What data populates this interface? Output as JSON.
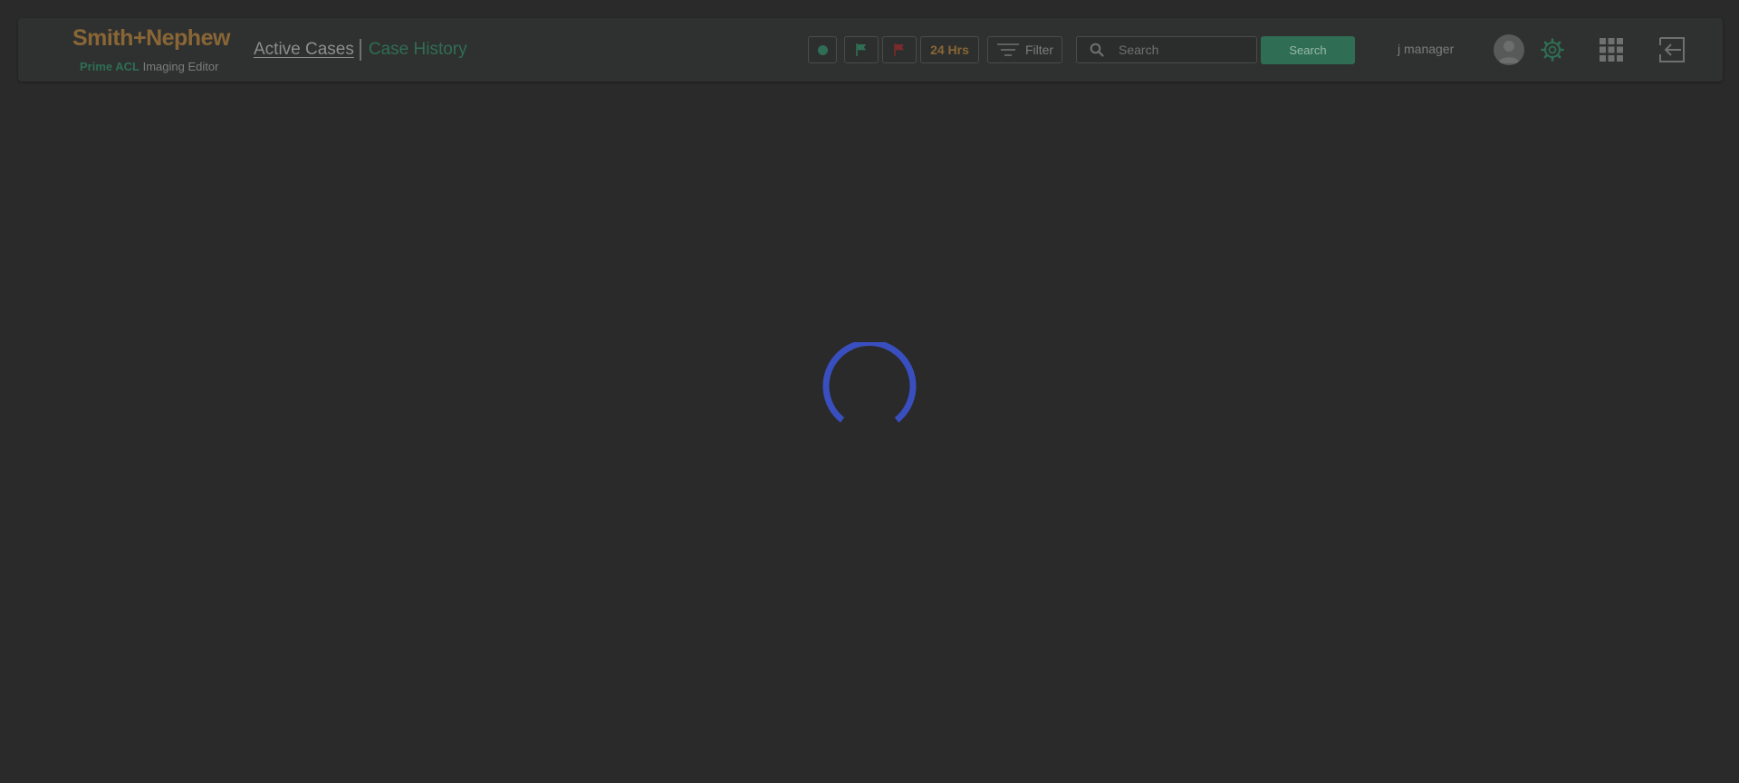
{
  "brand": {
    "name_left": "Smith",
    "name_plus": "+",
    "name_right": "Nephew",
    "product_highlight": "Prime ACL",
    "product_rest": "Imaging Editor"
  },
  "nav": {
    "tab_active": "Active Cases",
    "tab_history": "Case History"
  },
  "toolbar": {
    "hours_label": "24 Hrs",
    "filter_label": "Filter"
  },
  "search": {
    "placeholder": "Search",
    "button_label": "Search"
  },
  "user": {
    "name": "j manager"
  },
  "icons": {
    "status_dot": "circle-dot-icon",
    "green_flag": "flag-icon",
    "red_flag": "flag-icon",
    "filter": "filter-lines-icon",
    "search": "search-icon",
    "avatar": "user-avatar-icon",
    "settings": "gear-icon",
    "apps": "grid-icon",
    "logout": "logout-arrow-icon",
    "loading": "spinner-icon"
  },
  "colors": {
    "background": "#2a2a2a",
    "header_bg": "#2f3130",
    "brand": "#8a6636",
    "accent_green": "#2f6e55",
    "flag_red": "#7a2a2a",
    "spinner": "#3a4fbf"
  }
}
